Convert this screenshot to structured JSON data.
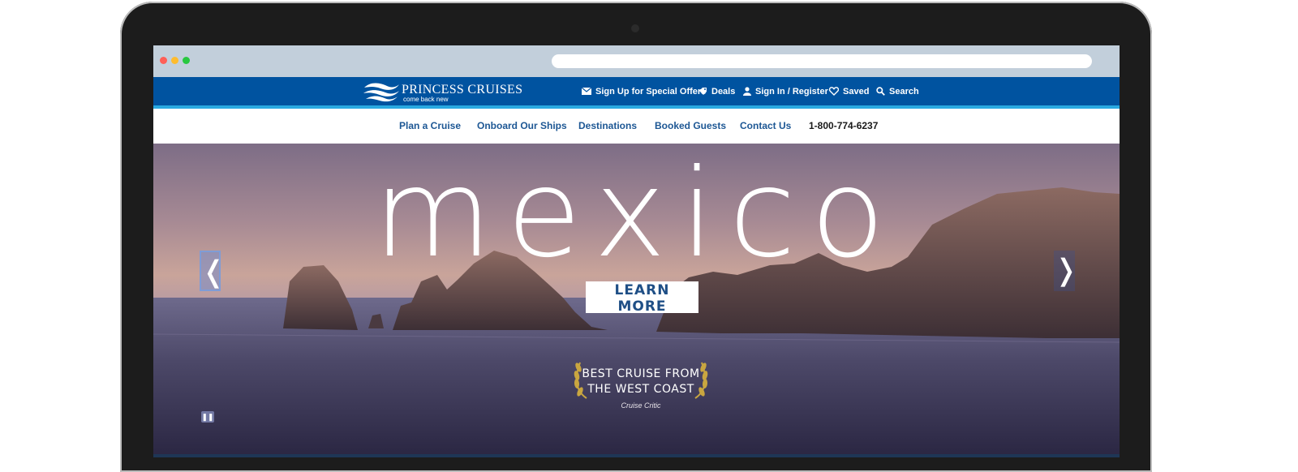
{
  "brand": {
    "name": "PRINCESS CRUISES",
    "tagline": "come back new"
  },
  "utility_nav": [
    {
      "label": "Sign Up for Special Offers",
      "icon": "envelope-icon"
    },
    {
      "label": "Deals",
      "icon": "tag-icon"
    },
    {
      "label": "Sign In / Register",
      "icon": "user-icon"
    },
    {
      "label": "Saved",
      "icon": "heart-icon"
    },
    {
      "label": "Search",
      "icon": "search-icon"
    }
  ],
  "main_nav": [
    {
      "label": "Plan a Cruise"
    },
    {
      "label": "Onboard Our Ships"
    },
    {
      "label": "Destinations"
    },
    {
      "label": "Booked Guests"
    },
    {
      "label": "Contact Us"
    }
  ],
  "phone": "1-800-774-6237",
  "hero": {
    "title": "mexico",
    "cta_label": "LEARN MORE",
    "prev_arrow": "❬",
    "next_arrow": "❭",
    "pause_icon": "pause-icon",
    "award": {
      "line1": "BEST CRUISE FROM",
      "line2": "THE WEST COAST",
      "source": "Cruise Critic"
    }
  },
  "colors": {
    "brand_blue": "#0053a0",
    "accent_cyan": "#29a9e1",
    "nav_text": "#1d5794",
    "laurel_gold": "#c9a640"
  }
}
